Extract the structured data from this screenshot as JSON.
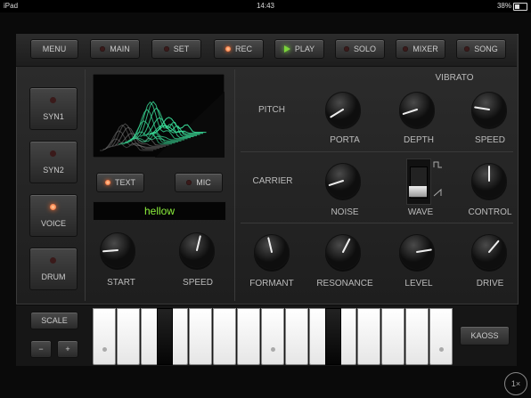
{
  "status": {
    "device": "iPad",
    "time": "14:43",
    "battery": "38%",
    "battery_level": 0.38
  },
  "topbar": [
    {
      "id": "menu",
      "label": "MENU",
      "led": "none"
    },
    {
      "id": "main",
      "label": "MAIN",
      "led": "off"
    },
    {
      "id": "set",
      "label": "SET",
      "led": "off"
    },
    {
      "id": "rec",
      "label": "REC",
      "led": "on"
    },
    {
      "id": "play",
      "label": "PLAY",
      "led": "play"
    },
    {
      "id": "solo",
      "label": "SOLO",
      "led": "off"
    },
    {
      "id": "mixer",
      "label": "MIXER",
      "led": "off"
    },
    {
      "id": "song",
      "label": "SONG",
      "led": "off"
    }
  ],
  "sidebar": [
    {
      "label": "SYN1",
      "active": false
    },
    {
      "label": "SYN2",
      "active": false
    },
    {
      "label": "VOICE",
      "active": true
    },
    {
      "label": "DRUM",
      "active": false
    }
  ],
  "voice": {
    "text_button": "TEXT",
    "text_active": true,
    "mic_button": "MIC",
    "mic_active": false,
    "lcd_text": "hellow",
    "start_label": "START",
    "speed_label": "SPEED",
    "start_value": 0.15,
    "speed_value": 0.55
  },
  "sections": {
    "vibrato": "VIBRATO",
    "pitch": "PITCH",
    "carrier": "CARRIER",
    "porta": "PORTA",
    "depth": "DEPTH",
    "speed": "SPEED",
    "noise": "NOISE",
    "wave": "WAVE",
    "control": "CONTROL",
    "formant": "FORMANT",
    "resonance": "RESONANCE",
    "level": "LEVEL",
    "drive": "DRIVE"
  },
  "knob_values": {
    "porta": 0.05,
    "depth": 0.1,
    "speed": 0.2,
    "noise": 0.1,
    "control": 0.5,
    "formant": 0.45,
    "resonance": 0.6,
    "level": 0.8,
    "drive": 0.65
  },
  "keyboard": {
    "scale": "SCALE",
    "minus": "−",
    "plus": "+",
    "kaoss": "KAOSS"
  },
  "zoom": "1×",
  "colors": {
    "led_on": "#ff5a20",
    "play": "#7bd43a",
    "lcd": "#8cf03c",
    "scope": "#3adf9a"
  }
}
